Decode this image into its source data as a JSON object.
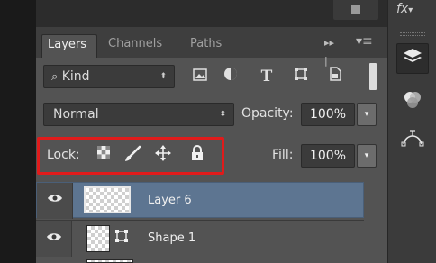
{
  "tabs": {
    "layers": "Layers",
    "channels": "Channels",
    "paths": "Paths",
    "collapse_icon": "▸▸ |",
    "menu_icon": "▾≡"
  },
  "filter": {
    "kind_label": "Kind",
    "search_icon": "⌕",
    "arrow": "⬍",
    "icons": [
      "image-filter-icon",
      "adjustment-filter-icon",
      "type-filter-icon",
      "shape-filter-icon",
      "smart-object-filter-icon"
    ],
    "type_glyph": "T"
  },
  "blend": {
    "mode": "Normal",
    "arrow": "⬍",
    "opacity_label": "Opacity:",
    "opacity_value": "100%",
    "dropdown_arrow": "▾"
  },
  "lock": {
    "label": "Lock:",
    "fill_label": "Fill:",
    "fill_value": "100%",
    "dropdown_arrow": "▾",
    "highlight_color": "#e01b1b"
  },
  "layers": [
    {
      "name": "Layer 6",
      "visible": true,
      "selected": true
    },
    {
      "name": "Shape 1",
      "visible": true,
      "selected": false
    }
  ],
  "side": {
    "fx": "fx",
    "fx_suffix": "▾",
    "icons": [
      "layers-panel-icon",
      "channels-panel-icon",
      "paths-panel-icon"
    ]
  },
  "colors": {
    "panel": "#535353",
    "selected_row": "#5d7591",
    "dark": "#3b3b3b"
  }
}
